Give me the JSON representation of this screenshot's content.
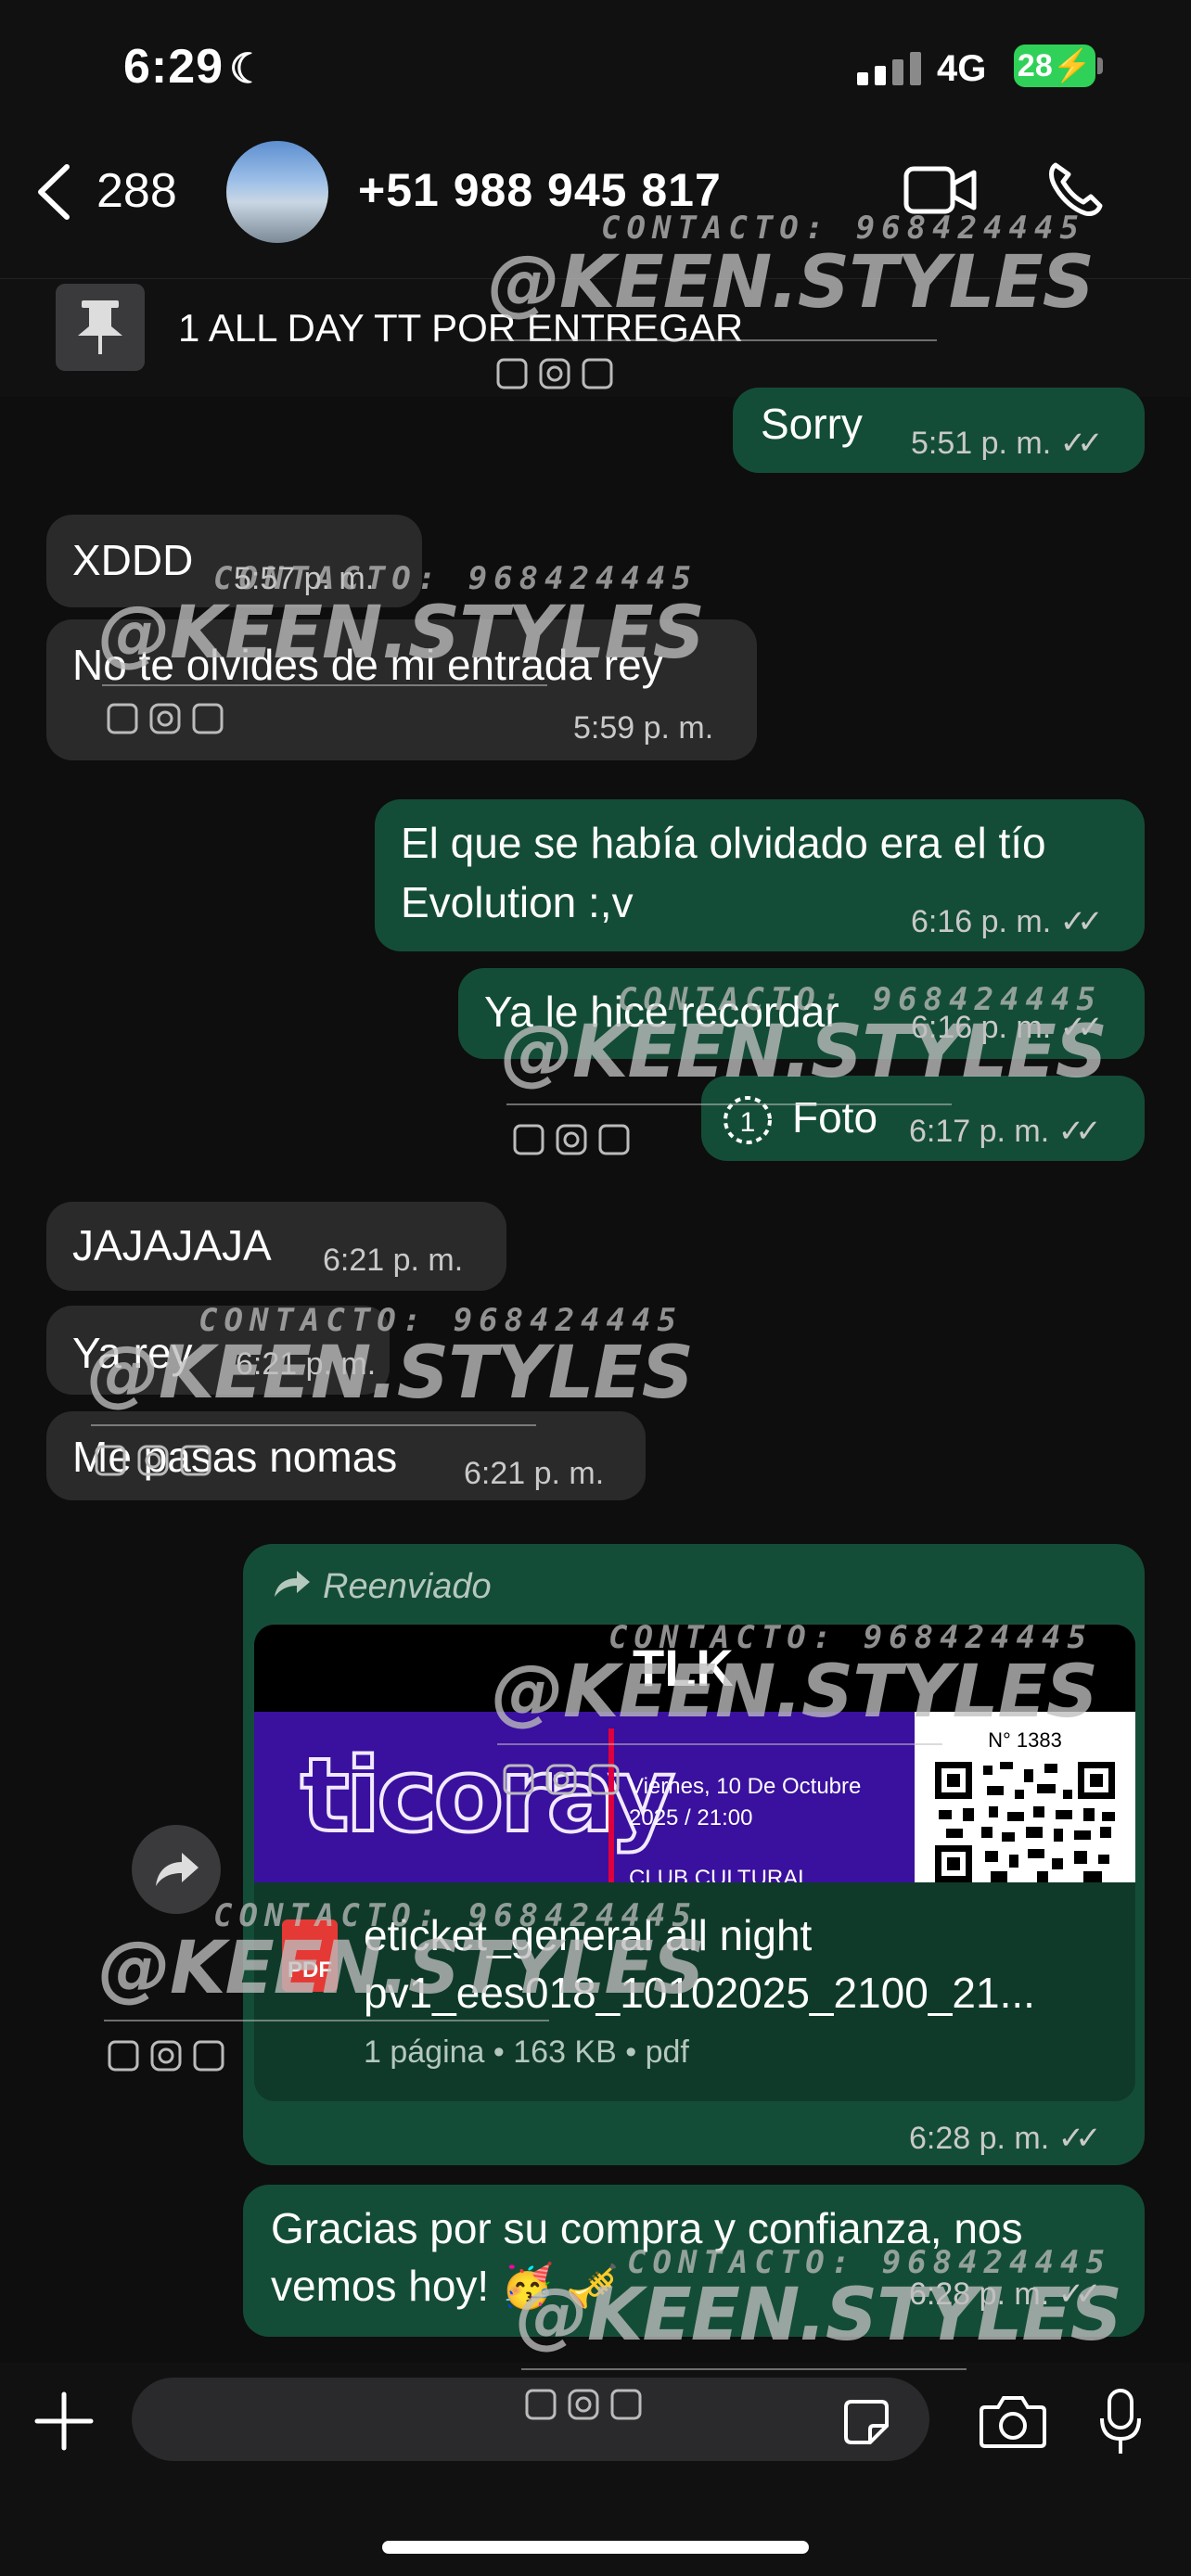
{
  "status_bar": {
    "time": "6:29",
    "network": "4G",
    "battery": "28"
  },
  "header": {
    "back_count": "288",
    "contact": "+51 988 945 817"
  },
  "pinned": {
    "text": "1 ALL DAY TT POR ENTREGAR"
  },
  "messages": [
    {
      "dir": "out",
      "text": "Sorry",
      "time": "5:51 p. m."
    },
    {
      "dir": "in",
      "text": "XDDD",
      "time": "5:57 p. m."
    },
    {
      "dir": "in",
      "text": "No te olvides de mi entrada rey",
      "time": "5:59 p. m."
    },
    {
      "dir": "out",
      "text_line1": "El que se había olvidado era el tío",
      "text_line2": "Evolution :,v",
      "time": "6:16 p. m."
    },
    {
      "dir": "out",
      "text": "Ya le hice recordar",
      "time": "6:16 p. m."
    },
    {
      "dir": "out",
      "text": "Foto",
      "time": "6:17 p. m."
    },
    {
      "dir": "in",
      "text": "JAJAJAJA",
      "time": "6:21 p. m."
    },
    {
      "dir": "in",
      "text": "Ya rey",
      "time": "6:21 p. m."
    },
    {
      "dir": "in",
      "text": "Me pasas nomas",
      "time": "6:21 p. m."
    }
  ],
  "forwarded": {
    "label": "Reenviado",
    "ticket": {
      "logo": "TLK",
      "brand": "ticoray",
      "number": "N° 1383",
      "date_line1": "Viernes, 10 De Octubre",
      "date_line2": "2025 / 21:00",
      "venue": "CLUB CULTURAL"
    },
    "pdf_badge": "PDF",
    "file_name_line1": "eticket_general all night",
    "file_name_line2": "pv1_ees018_10102025_2100_21...",
    "file_meta": "1 página • 163 KB • pdf",
    "time": "6:28 p. m."
  },
  "last_message": {
    "line1": "Gracias por su compra y confianza, nos",
    "line2": "vemos hoy! 🥳 🎺",
    "time": "6:28 p. m."
  },
  "watermark": {
    "contact": "CONTACTO: 968424445",
    "handle": "@KEEN.STYLES"
  },
  "colors": {
    "incoming": "#2a2a2a",
    "outgoing": "#144d37",
    "battery": "#30d158"
  }
}
